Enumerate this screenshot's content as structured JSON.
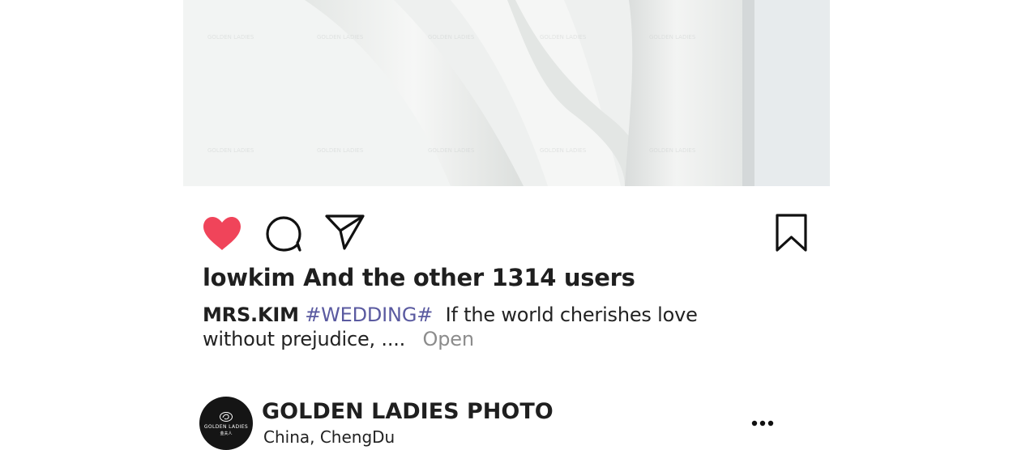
{
  "post": {
    "likes_text": "lowkim And the other 1314 users",
    "caption": {
      "username": "MRS.KIM",
      "hashtag": "#WEDDING#",
      "text": "If the world cherishes love without prejudice, ....",
      "open_label": "Open"
    },
    "liked": true,
    "like_color": "#f0445a"
  },
  "account": {
    "name": "GOLDEN LADIES PHOTO",
    "location": "China,  ChengDu",
    "avatar_logo_text": "GOLDEN LADIES",
    "avatar_logo_sub": "金夫人"
  },
  "photo": {
    "watermark_text": "GOLDEN LADIES"
  },
  "icons": {
    "like": "heart-icon",
    "comment": "comment-icon",
    "share": "send-icon",
    "save": "bookmark-icon",
    "more": "more-horizontal-icon"
  }
}
